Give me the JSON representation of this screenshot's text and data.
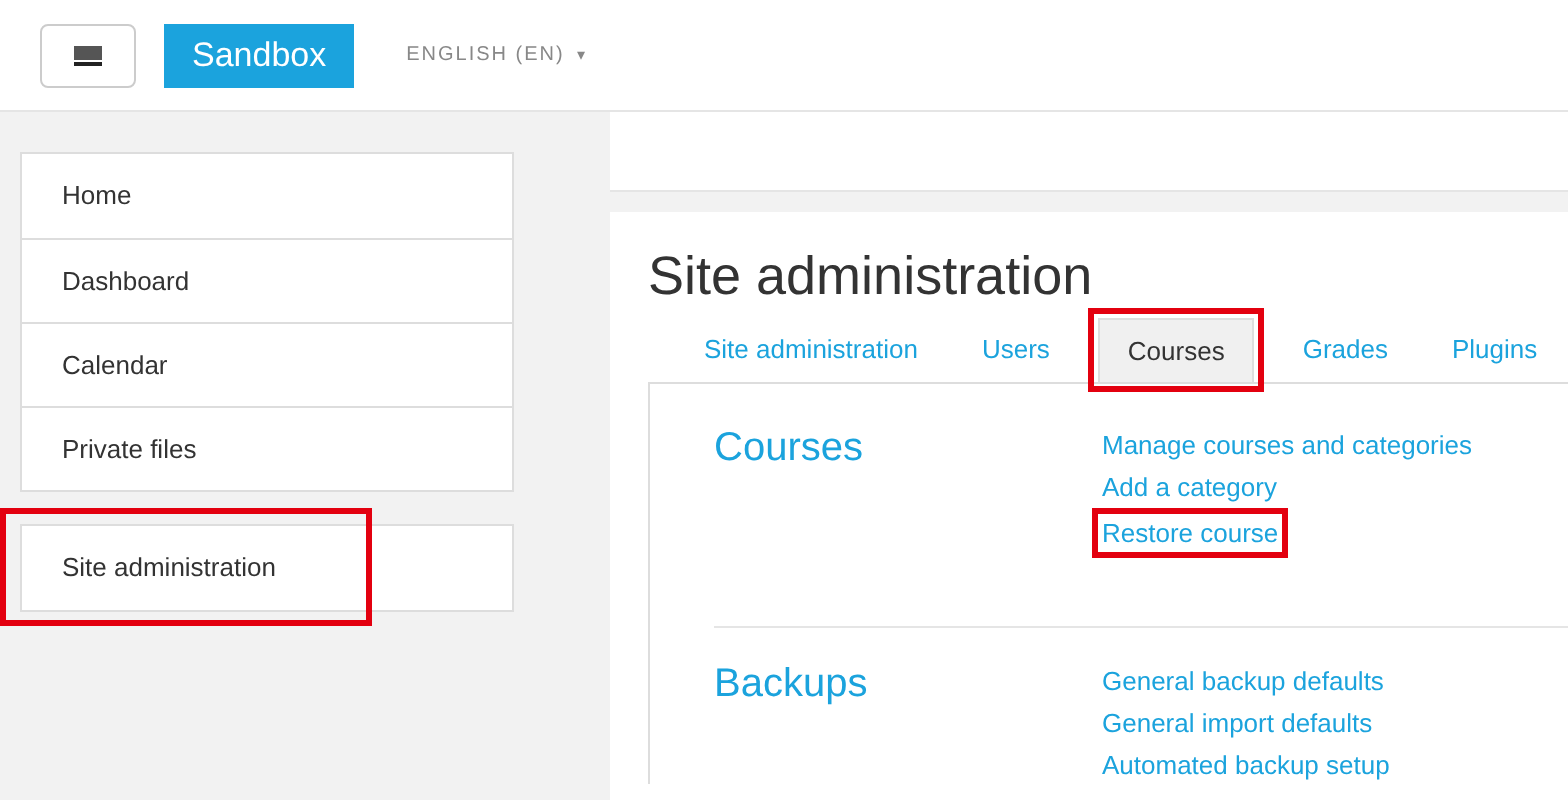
{
  "header": {
    "brand": "Sandbox",
    "language": "ENGLISH (EN)",
    "language_caret": "▾"
  },
  "sidebar": {
    "groups": [
      [
        {
          "label": "Home",
          "highlighted": false
        },
        {
          "label": "Dashboard",
          "highlighted": false
        },
        {
          "label": "Calendar",
          "highlighted": false
        },
        {
          "label": "Private files",
          "highlighted": false
        }
      ],
      [
        {
          "label": "Site administration",
          "highlighted": true
        }
      ]
    ]
  },
  "page": {
    "title": "Site administration",
    "tabs": [
      {
        "label": "Site administration",
        "selected": false,
        "highlighted": false
      },
      {
        "label": "Users",
        "selected": false,
        "highlighted": false
      },
      {
        "label": "Courses",
        "selected": true,
        "highlighted": true
      },
      {
        "label": "Grades",
        "selected": false,
        "highlighted": false
      },
      {
        "label": "Plugins",
        "selected": false,
        "highlighted": false
      }
    ],
    "sections": [
      {
        "heading": "Courses",
        "links": [
          {
            "label": "Manage courses and categories",
            "highlighted": false
          },
          {
            "label": "Add a category",
            "highlighted": false
          },
          {
            "label": "Restore course",
            "highlighted": true
          }
        ]
      },
      {
        "heading": "Backups",
        "links": [
          {
            "label": "General backup defaults",
            "highlighted": false
          },
          {
            "label": "General import defaults",
            "highlighted": false
          },
          {
            "label": "Automated backup setup",
            "highlighted": false
          }
        ]
      }
    ]
  }
}
